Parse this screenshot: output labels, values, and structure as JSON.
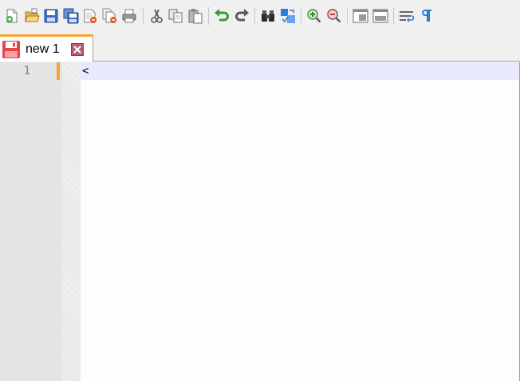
{
  "toolbar": {
    "groups": [
      [
        "new-file-icon",
        "open-file-icon",
        "save-icon",
        "save-all-icon",
        "close-icon",
        "close-all-icon",
        "print-icon"
      ],
      [
        "cut-icon",
        "copy-icon",
        "paste-icon"
      ],
      [
        "undo-icon",
        "redo-icon"
      ],
      [
        "find-icon",
        "replace-icon"
      ],
      [
        "zoom-in-icon",
        "zoom-out-icon"
      ],
      [
        "sync-vertical-icon",
        "sync-horizontal-icon"
      ],
      [
        "word-wrap-icon",
        "show-all-chars-icon"
      ]
    ]
  },
  "tabs": [
    {
      "label": "new 1",
      "icon": "unsaved-disk-icon",
      "close_icon": "tab-close-icon",
      "active": true
    }
  ],
  "editor": {
    "lines": [
      {
        "number": "1",
        "text": "<"
      }
    ],
    "colors": {
      "current_line": "#e8e8ff",
      "change_mark": "#f7a32f",
      "gutter": "#e4e4e4",
      "tab_accent": "#f7a32f"
    }
  }
}
